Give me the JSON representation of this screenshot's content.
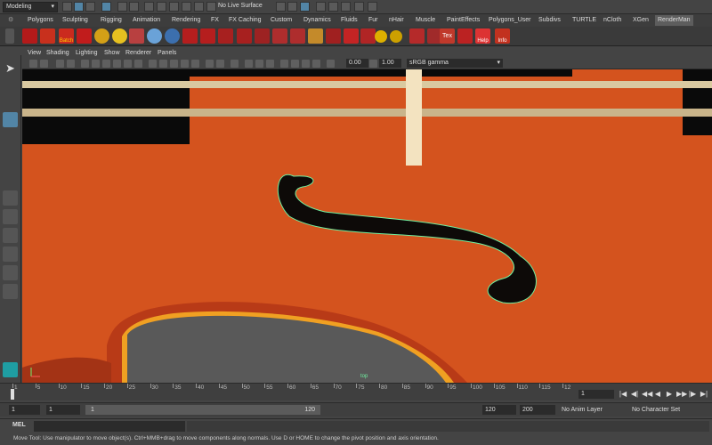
{
  "statusline": {
    "mode": "Modeling",
    "live_surface": "No Live Surface"
  },
  "shelf_tabs": [
    "Polygons",
    "Sculpting",
    "Rigging",
    "Animation",
    "Rendering",
    "FX",
    "FX Caching",
    "Custom",
    "Dynamics",
    "Fluids",
    "Fur",
    "nHair",
    "Muscle",
    "PaintEffects",
    "Polygons_User",
    "Subdivs",
    "TURTLE",
    "nCloth",
    "XGen",
    "RenderMan"
  ],
  "active_tab": "RenderMan",
  "shelf_labels": {
    "batch": "Batch",
    "tex": "Tex",
    "help": "Help",
    "info": "Info"
  },
  "panel_menu": [
    "View",
    "Shading",
    "Lighting",
    "Show",
    "Renderer",
    "Panels"
  ],
  "panel_toolbar": {
    "exposure": "0.00",
    "gamma": "1.00",
    "color_space": "sRGB gamma"
  },
  "viewport": {
    "camera_label": "top"
  },
  "timeslider": {
    "ticks": [
      "1",
      "5",
      "10",
      "15",
      "20",
      "25",
      "30",
      "35",
      "40",
      "45",
      "50",
      "55",
      "60",
      "65",
      "70",
      "75",
      "80",
      "85",
      "90",
      "95",
      "100",
      "105",
      "110",
      "115",
      "12"
    ],
    "current_frame": "1"
  },
  "range": {
    "start_time": "1",
    "playback_start": "1",
    "bar_start": "1",
    "bar_end": "120",
    "playback_end": "120",
    "end_time": "200",
    "anim_layer": "No Anim Layer",
    "character_set": "No Character Set"
  },
  "cmdline": {
    "label": "MEL"
  },
  "helpline": {
    "text": "Move Tool: Use manipulator to move object(s). Ctrl+MMB+drag to move components along normals. Use D or HOME to change the pivot position and axis orientation."
  },
  "colors": {
    "viewport_bg": "#d4531e",
    "accent": "#5285a6",
    "curve": "#6ff0a0"
  }
}
